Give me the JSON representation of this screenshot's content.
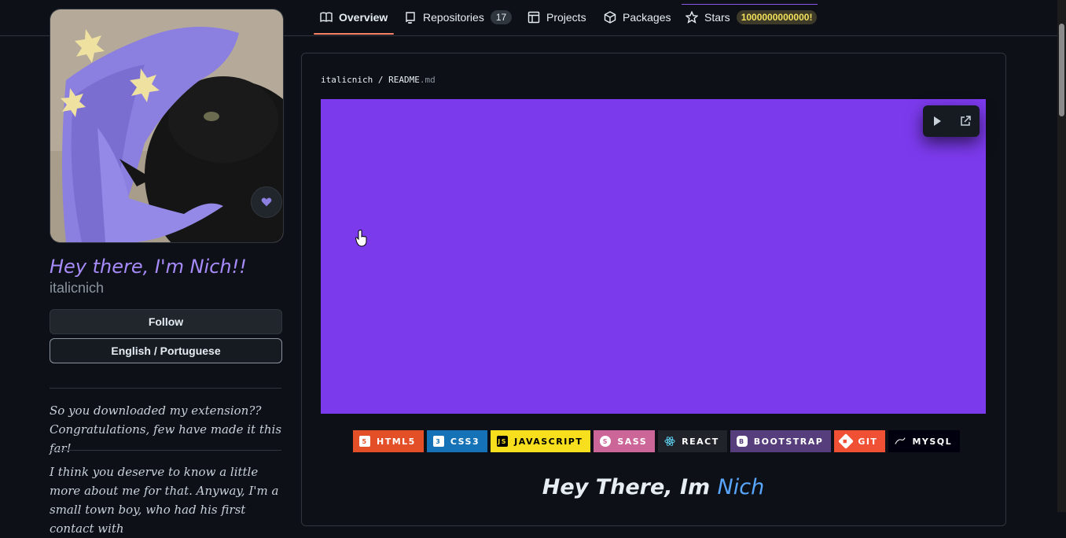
{
  "nav": {
    "tabs": [
      {
        "label": "Overview",
        "icon": "book-icon"
      },
      {
        "label": "Repositories",
        "icon": "repo-icon",
        "count": "17"
      },
      {
        "label": "Projects",
        "icon": "table-icon"
      },
      {
        "label": "Packages",
        "icon": "package-icon"
      },
      {
        "label": "Stars",
        "icon": "star-icon",
        "count": "1000000000000!"
      }
    ]
  },
  "profile": {
    "display_name": "Hey there, I'm Nich!!",
    "username": "italicnich",
    "follow_label": "Follow",
    "language_label": "English / Portuguese",
    "bio_1": "So you downloaded my extension?? Congratulations, few have made it this far!",
    "bio_2": "I think you deserve to know a little more about me for that. Anyway, I'm a small town boy, who had his first contact with"
  },
  "readme": {
    "owner": "italicnich",
    "sep": "/",
    "file": "README",
    "ext": ".md",
    "badges": [
      {
        "label": "HTML5",
        "color": "#e34f26"
      },
      {
        "label": "CSS3",
        "color": "#1572b6"
      },
      {
        "label": "JAVASCRIPT",
        "color": "#f7df1e"
      },
      {
        "label": "SASS",
        "color": "#cc6699"
      },
      {
        "label": "REACT",
        "color": "#20232a"
      },
      {
        "label": "BOOTSTRAP",
        "color": "#563d7c"
      },
      {
        "label": "GIT",
        "color": "#f05033"
      },
      {
        "label": "MYSQL",
        "color": "#00000f"
      }
    ],
    "heading_prefix": "Hey There, Im ",
    "heading_name": "Nich"
  },
  "colors": {
    "accent": "#a78bfa",
    "banner": "#7c3aed",
    "tab_underline": "#f78166",
    "link": "#58a6ff"
  }
}
